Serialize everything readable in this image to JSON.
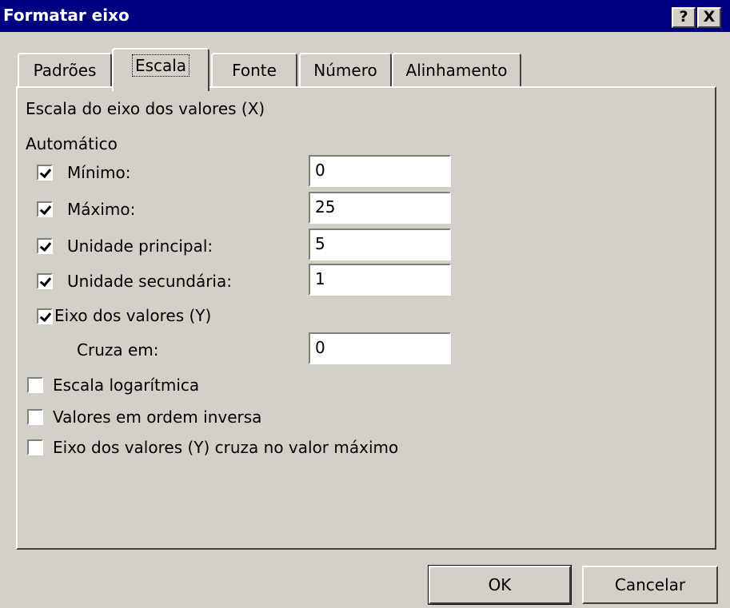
{
  "window": {
    "title": "Formatar eixo",
    "help_label": "?",
    "close_label": "X"
  },
  "tabs": [
    {
      "label": "Padrões",
      "active": false
    },
    {
      "label": "Escala",
      "active": true
    },
    {
      "label": "Fonte",
      "active": false
    },
    {
      "label": "Número",
      "active": false
    },
    {
      "label": "Alinhamento",
      "active": false
    }
  ],
  "scale": {
    "heading": "Escala do eixo dos valores (X)",
    "auto_label": "Automático",
    "minimum": {
      "label": "Mínimo:",
      "checked": true,
      "value": "0"
    },
    "maximum": {
      "label": "Máximo:",
      "checked": true,
      "value": "25"
    },
    "major_unit": {
      "label": "Unidade principal:",
      "checked": true,
      "value": "5"
    },
    "minor_unit": {
      "label": "Unidade secundária:",
      "checked": true,
      "value": "1"
    },
    "y_axis": {
      "label": "Eixo dos valores (Y)",
      "checked": true
    },
    "crosses_at": {
      "label": "Cruza em:",
      "value": "0"
    },
    "log_scale": {
      "label": "Escala logarítmica",
      "checked": false
    },
    "reverse_order": {
      "label": "Valores em ordem inversa",
      "checked": false
    },
    "crosses_at_max": {
      "label": "Eixo dos valores (Y) cruza no valor máximo",
      "checked": false
    }
  },
  "buttons": {
    "ok": "OK",
    "cancel": "Cancelar"
  }
}
